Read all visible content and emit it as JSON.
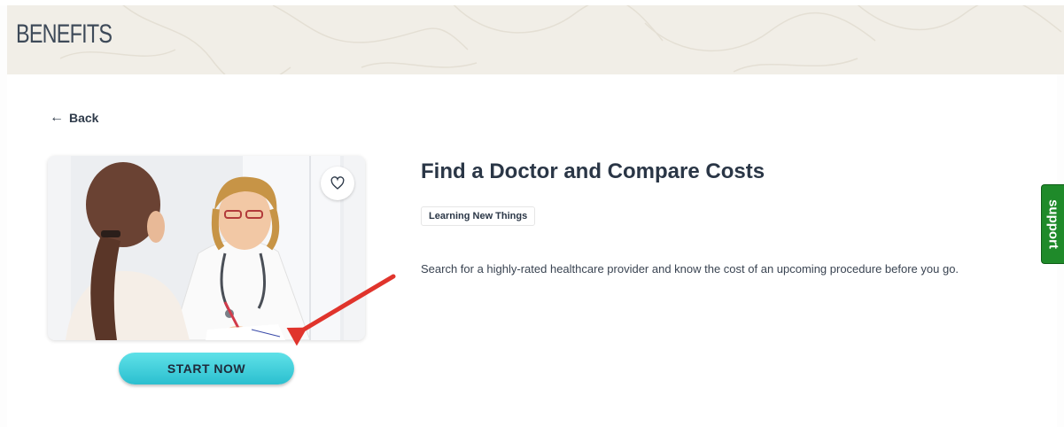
{
  "banner": {
    "title": "BENEFITS"
  },
  "nav": {
    "back_label": "Back",
    "back_icon": "arrow-left-icon"
  },
  "card": {
    "image_alt": "Doctor consulting with patient",
    "favorite_icon": "heart-outline-icon",
    "cta_label": "START NOW"
  },
  "benefit": {
    "title": "Find a Doctor and Compare Costs",
    "tag": "Learning New Things",
    "description": "Search for a highly-rated healthcare provider and know the cost of an upcoming procedure before you go."
  },
  "support": {
    "label": "support"
  },
  "colors": {
    "banner_bg": "#f1eee7",
    "cta_gradient_top": "#5fe1e8",
    "cta_gradient_bottom": "#2bbfcf",
    "support_green": "#1f8a2a",
    "annotation_red": "#e0342c"
  }
}
